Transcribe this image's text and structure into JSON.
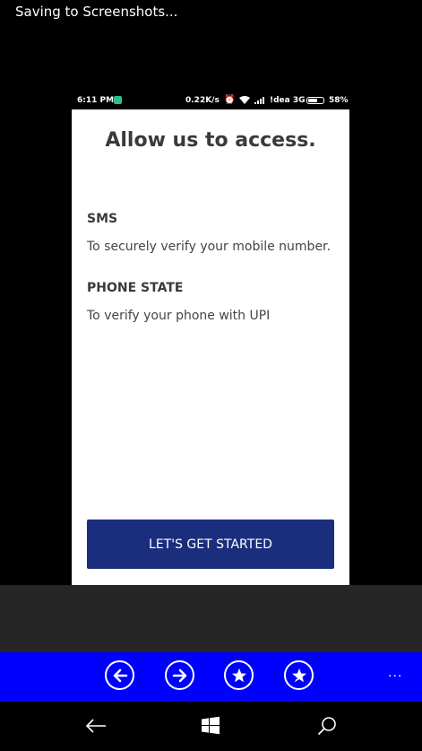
{
  "saving_text": "Saving to Screenshots...",
  "inner_status": {
    "time": "6:11 PM",
    "speed": "0.22K/s",
    "carrier": "!dea 3G",
    "battery": "58%"
  },
  "inner_page": {
    "title": "Allow us to access.",
    "permissions": [
      {
        "heading": "SMS",
        "description": "To securely verify your mobile number."
      },
      {
        "heading": "PHONE STATE",
        "description": "To verify your phone with UPI"
      }
    ],
    "start_label": "LET'S GET STARTED"
  },
  "app_bar": {
    "icons": [
      "back-circle-icon",
      "forward-circle-icon",
      "favorite-star-icon",
      "add-favorite-icon"
    ],
    "more_label": "..."
  },
  "nav_bar": {
    "icons": [
      "back-arrow-icon",
      "windows-start-icon",
      "search-icon"
    ]
  },
  "colors": {
    "app_bar": "#0000ff",
    "button": "#1b2e7e",
    "notification": "#2bbf8a"
  }
}
